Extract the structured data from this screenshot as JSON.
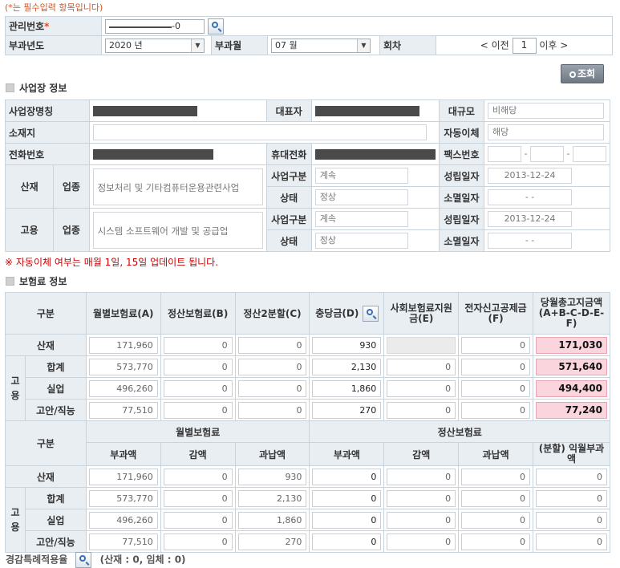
{
  "notice_required": "(*는 필수입력 항목입니다)",
  "header": {
    "mgmt_no_label": "관리번호",
    "mgmt_no_suffix": "-0",
    "year_label": "부과년도",
    "year_value": "2020 년",
    "month_label": "부과월",
    "month_value": "07 월",
    "round_label": "회차",
    "prev_label": "< 이전",
    "next_label": "이후 >",
    "round_value": "1"
  },
  "search_button": "조회",
  "workplace": {
    "section_title": "사업장 정보",
    "name_label": "사업장명칭",
    "rep_label": "대표자",
    "size_label": "대규모",
    "size_value": "비해당",
    "address_label": "소재지",
    "autopay_label": "자동이체",
    "autopay_value": "해당",
    "phone_label": "전화번호",
    "mobile_label": "휴대전화",
    "fax_label": "팩스번호",
    "fax_sep1": "-",
    "fax_sep2": "-",
    "sanjae_label": "산재",
    "goyong_label": "고용",
    "industry_label": "업종",
    "sanjae_industry": "정보처리 및 기타컴퓨터운용관련사업",
    "goyong_industry": "시스템 소프트웨어 개발 및 공급업",
    "biz_type_label": "사업구분",
    "status_label": "상태",
    "est_date_label": "성립일자",
    "ext_date_label": "소멸일자",
    "sanjae_biz_type": "계속",
    "sanjae_status": "정상",
    "sanjae_est_date": "2013-12-24",
    "sanjae_ext_date": "- -",
    "goyong_biz_type": "계속",
    "goyong_status": "정상",
    "goyong_est_date": "2013-12-24",
    "goyong_ext_date": "- -"
  },
  "autopay_notice": "※ 자동이체 여부는 매월 1일, 15일 업데이트 됩니다.",
  "insurance": {
    "section_title": "보험료 정보",
    "col_category": "구분",
    "col_monthly": "월별보험료(A)",
    "col_settle": "정산보험료(B)",
    "col_settle2": "정산2분할(C)",
    "col_appropriation": "충당금(D)",
    "col_social_support": "사회보험료지원금(E)",
    "col_edeclare": "전자신고공제금(F)",
    "col_total": "당월총고지금액 (A+B-C-D-E-F)",
    "row_sanjae": "산재",
    "row_goyong": "고용",
    "row_total": "합계",
    "row_unemp": "실업",
    "row_stab": "고안/직능",
    "rows": [
      {
        "a": "171,960",
        "b": "0",
        "c": "0",
        "d": "930",
        "e": "",
        "f": "0",
        "total": "171,030"
      },
      {
        "a": "573,770",
        "b": "0",
        "c": "0",
        "d": "2,130",
        "e": "0",
        "f": "0",
        "total": "571,640"
      },
      {
        "a": "496,260",
        "b": "0",
        "c": "0",
        "d": "1,860",
        "e": "0",
        "f": "0",
        "total": "494,400"
      },
      {
        "a": "77,510",
        "b": "0",
        "c": "0",
        "d": "270",
        "e": "0",
        "f": "0",
        "total": "77,240"
      }
    ],
    "group_monthly": "월별보험료",
    "group_settle": "정산보험료",
    "col_levy": "부과액",
    "col_reduction": "감액",
    "col_overpay": "과납액",
    "col_installment": "(분할) 익월부과액",
    "rows2": [
      {
        "m_levy": "171,960",
        "m_red": "0",
        "m_over": "930",
        "s_levy": "0",
        "s_red": "0",
        "s_over": "0",
        "s_inst": "0"
      },
      {
        "m_levy": "573,770",
        "m_red": "0",
        "m_over": "2,130",
        "s_levy": "0",
        "s_red": "0",
        "s_over": "0",
        "s_inst": "0"
      },
      {
        "m_levy": "496,260",
        "m_red": "0",
        "m_over": "1,860",
        "s_levy": "0",
        "s_red": "0",
        "s_over": "0",
        "s_inst": "0"
      },
      {
        "m_levy": "77,510",
        "m_red": "0",
        "m_over": "270",
        "s_levy": "0",
        "s_red": "0",
        "s_over": "0",
        "s_inst": "0"
      }
    ]
  },
  "bottom": {
    "label": "경감특례적용율",
    "detail": "(산재 : 0, 임체 : 0)"
  }
}
